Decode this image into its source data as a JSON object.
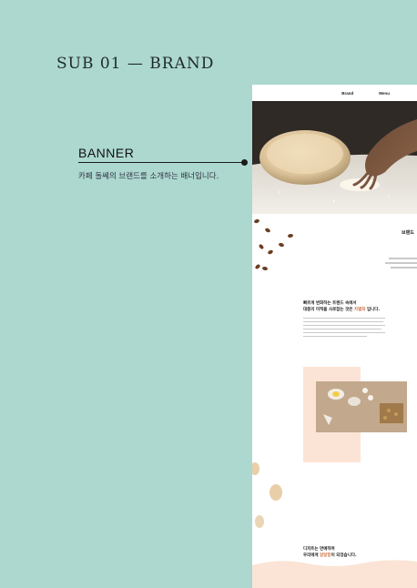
{
  "page_title": "SUB 01 — BRAND",
  "banner": {
    "label": "BANNER",
    "description": "카페 돌쎄의 브랜드를 소개하는 배너입니다."
  },
  "mockup": {
    "nav": [
      "Brand",
      "Menu"
    ],
    "section_title_partial": "브랜드",
    "intro_heading_line1": "빠르게 변화하는 트렌드 속에서",
    "intro_heading_line2_prefix": "대중의 미적을 사로잡는 것은",
    "intro_heading_highlight": "차별화",
    "intro_heading_line2_suffix": "입니다.",
    "story_heading_line1": "디저트는 연예하며",
    "story_heading_prefix": "우리에게",
    "story_heading_highlight": "달달함",
    "story_heading_suffix": "이 되었습니다."
  },
  "colors": {
    "background": "#acd8cf",
    "accent": "#d07a52",
    "peach": "#fbe4d6"
  }
}
